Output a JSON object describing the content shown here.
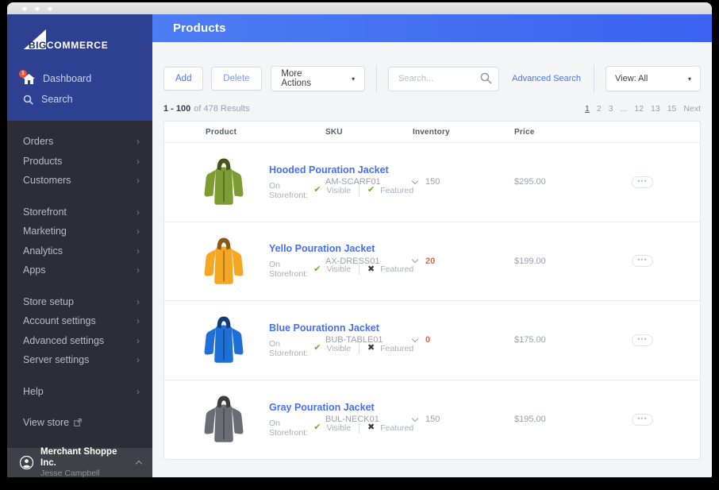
{
  "window": {
    "title_dots": 3
  },
  "logo": {
    "big": "BIG",
    "commerce": "COMMERCE"
  },
  "sidebar": {
    "top_items": [
      {
        "label": "Dashboard",
        "icon": "home-icon",
        "badge": "1"
      },
      {
        "label": "Search",
        "icon": "search-icon"
      }
    ],
    "nav_groups": [
      {
        "items": [
          "Orders",
          "Products",
          "Customers"
        ]
      },
      {
        "items": [
          "Storefront",
          "Marketing",
          "Analytics",
          "Apps"
        ]
      },
      {
        "items": [
          "Store setup",
          "Account settings",
          "Advanced settings",
          "Server settings"
        ]
      },
      {
        "items": [
          "Help"
        ]
      }
    ],
    "view_store_label": "View store",
    "user": {
      "company": "Merchant Shoppe Inc.",
      "name": "Jesse Campbell"
    }
  },
  "header": {
    "title": "Products"
  },
  "toolbar": {
    "add_label": "Add",
    "delete_label": "Delete",
    "more_actions_label": "More Actions",
    "search_placeholder": "Search...",
    "advanced_search_label": "Advanced Search",
    "view_filter_value": "View: All"
  },
  "results": {
    "range": "1 - 100",
    "suffix": "of 478 Results"
  },
  "pagination": {
    "pages": [
      "1",
      "2",
      "3",
      "...",
      "12",
      "13",
      "15"
    ],
    "current": "1",
    "next_label": "Next"
  },
  "table": {
    "columns": [
      "Product",
      "SKU",
      "Inventory",
      "Price",
      ""
    ],
    "storefront_label": "On Storefront:",
    "visible_label": "Visible",
    "featured_label": "Featured",
    "rows": [
      {
        "name": "Hooded Pouration Jacket",
        "jacket_color": "#7d9c31",
        "sku": "AM-SCARF01",
        "inventory": "150",
        "inventory_low": false,
        "price": "$295.00",
        "visible": true,
        "featured": true
      },
      {
        "name": "Yello Pouration Jacket",
        "jacket_color": "#f5a623",
        "sku": "AX-DRESS01",
        "inventory": "20",
        "inventory_low": true,
        "price": "$199.00",
        "visible": true,
        "featured": false
      },
      {
        "name": "Blue Pourationn Jacket",
        "jacket_color": "#1f6fd8",
        "sku": "BUB-TABLE01",
        "inventory": "0",
        "inventory_low": true,
        "price": "$175.00",
        "visible": true,
        "featured": false
      },
      {
        "name": "Gray Pouration Jacket",
        "jacket_color": "#6b6b74",
        "sku": "BUL-NECK01",
        "inventory": "150",
        "inventory_low": false,
        "price": "$195.00",
        "visible": true,
        "featured": false
      }
    ]
  },
  "icons": {
    "check": "✔",
    "cross": "✖",
    "caret_down": "▾",
    "chevron_right": "›",
    "ellipsis": "•••"
  },
  "colors": {
    "header_blue_left": "#4d7df2",
    "header_blue_right": "#3b62f1",
    "sidebar_blue": "#2d4092",
    "sidebar_dark": "#2d2d38",
    "link_blue": "#4576f2",
    "success_green": "#6cb21e",
    "low_stock_red": "#e8604a"
  }
}
